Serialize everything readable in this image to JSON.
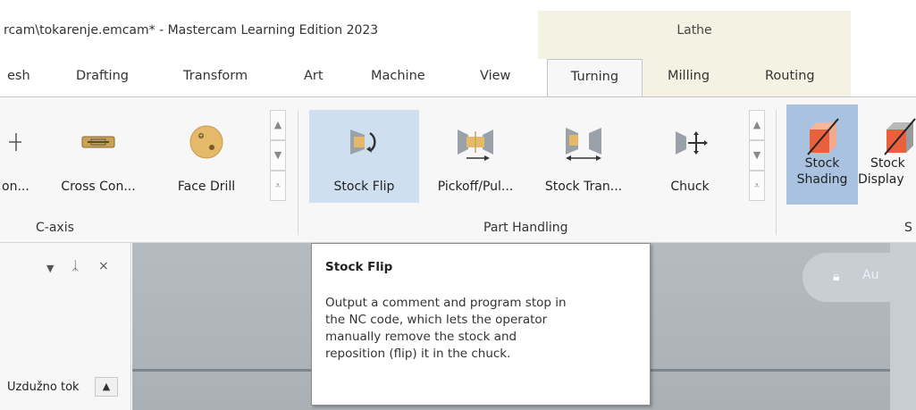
{
  "window": {
    "title": "rcam\\tokarenje.emcam* - Mastercam Learning Edition 2023",
    "context_tab_group": "Lathe"
  },
  "tabs": [
    {
      "label": "esh"
    },
    {
      "label": "Drafting"
    },
    {
      "label": "Transform"
    },
    {
      "label": "Art"
    },
    {
      "label": "Machine"
    },
    {
      "label": "View"
    },
    {
      "label": "Turning",
      "active": true
    },
    {
      "label": "Milling"
    },
    {
      "label": "Routing"
    }
  ],
  "ribbon": {
    "c_axis": {
      "label": "C-axis",
      "buttons": [
        {
          "label": "on...",
          "icon": "c-axis-contour-icon"
        },
        {
          "label": "Cross Con...",
          "icon": "cross-contour-icon"
        },
        {
          "label": "Face Drill",
          "icon": "face-drill-icon"
        }
      ]
    },
    "part_handling": {
      "label": "Part Handling",
      "buttons": [
        {
          "label": "Stock Flip",
          "icon": "stock-flip-icon",
          "selected": true
        },
        {
          "label": "Pickoff/Pul...",
          "icon": "pickoff-pull-icon"
        },
        {
          "label": "Stock Tran...",
          "icon": "stock-transfer-icon"
        },
        {
          "label": "Chuck",
          "icon": "chuck-icon"
        }
      ]
    },
    "stock": {
      "label": "S",
      "buttons": [
        {
          "label_line1": "Stock",
          "label_line2": "Shading",
          "icon": "stock-shading-icon",
          "active": true
        },
        {
          "label_line1": "Stock",
          "label_line2": "Display",
          "icon": "stock-display-icon"
        }
      ]
    }
  },
  "left_panel": {
    "tree_item": "Uzdužno tok",
    "controls": [
      "▼",
      "ᛣ",
      "×"
    ]
  },
  "viewport": {
    "autocursor_label": "Au"
  },
  "tooltip": {
    "title": "Stock Flip",
    "body": "Output a comment and program stop in\nthe NC code, which lets the operator\nmanually remove the stock and\nreposition (flip) it in the chuck."
  },
  "colors": {
    "context_band": "#f4f2e2",
    "selected_button": "#cfdff0",
    "active_toggle": "#a8c2e0",
    "viewport_bg": "#b4bbc1"
  }
}
